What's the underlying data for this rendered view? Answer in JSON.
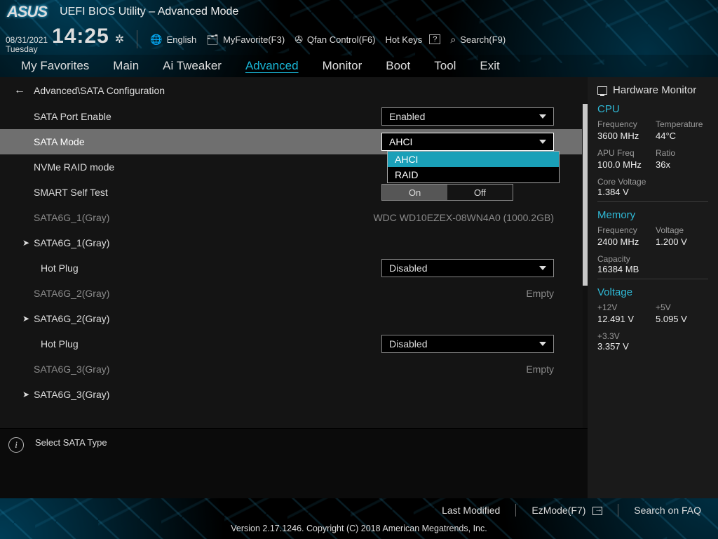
{
  "brand": "ASUS",
  "title": "UEFI BIOS Utility – Advanced Mode",
  "datetime": {
    "date": "08/31/2021",
    "day": "Tuesday",
    "time": "14:25"
  },
  "toolbar": {
    "language": "English",
    "myfavorite": "MyFavorite(F3)",
    "qfan": "Qfan Control(F6)",
    "hotkeys": "Hot Keys",
    "search": "Search(F9)"
  },
  "tabs": [
    "My Favorites",
    "Main",
    "Ai Tweaker",
    "Advanced",
    "Monitor",
    "Boot",
    "Tool",
    "Exit"
  ],
  "active_tab": "Advanced",
  "breadcrumb": "Advanced\\SATA Configuration",
  "settings": {
    "sata_port_enable": {
      "label": "SATA Port Enable",
      "value": "Enabled"
    },
    "sata_mode": {
      "label": "SATA Mode",
      "value": "AHCI",
      "options": [
        "AHCI",
        "RAID"
      ]
    },
    "nvme_raid": {
      "label": "NVMe RAID mode"
    },
    "smart": {
      "label": "SMART Self Test",
      "on": "On",
      "off": "Off",
      "value": "On"
    },
    "port1_info": {
      "label": "SATA6G_1(Gray)",
      "value": "WDC WD10EZEX-08WN4A0 (1000.2GB)"
    },
    "port1_hdr": {
      "label": "SATA6G_1(Gray)"
    },
    "hotplug1": {
      "label": "Hot Plug",
      "value": "Disabled"
    },
    "port2_info": {
      "label": "SATA6G_2(Gray)",
      "value": "Empty"
    },
    "port2_hdr": {
      "label": "SATA6G_2(Gray)"
    },
    "hotplug2": {
      "label": "Hot Plug",
      "value": "Disabled"
    },
    "port3_info": {
      "label": "SATA6G_3(Gray)",
      "value": "Empty"
    },
    "port3_hdr": {
      "label": "SATA6G_3(Gray)"
    }
  },
  "help_text": "Select SATA Type",
  "sidebar": {
    "title": "Hardware Monitor",
    "cpu": {
      "title": "CPU",
      "frequency_k": "Frequency",
      "frequency_v": "3600 MHz",
      "temperature_k": "Temperature",
      "temperature_v": "44°C",
      "apu_k": "APU Freq",
      "apu_v": "100.0 MHz",
      "ratio_k": "Ratio",
      "ratio_v": "36x",
      "corev_k": "Core Voltage",
      "corev_v": "1.384 V"
    },
    "memory": {
      "title": "Memory",
      "frequency_k": "Frequency",
      "frequency_v": "2400 MHz",
      "voltage_k": "Voltage",
      "voltage_v": "1.200 V",
      "capacity_k": "Capacity",
      "capacity_v": "16384 MB"
    },
    "voltage": {
      "title": "Voltage",
      "p12_k": "+12V",
      "p12_v": "12.491 V",
      "p5_k": "+5V",
      "p5_v": "5.095 V",
      "p33_k": "+3.3V",
      "p33_v": "3.357 V"
    }
  },
  "footer": {
    "last_modified": "Last Modified",
    "ezmode": "EzMode(F7)",
    "search_faq": "Search on FAQ",
    "version": "Version 2.17.1246. Copyright (C) 2018 American Megatrends, Inc."
  }
}
